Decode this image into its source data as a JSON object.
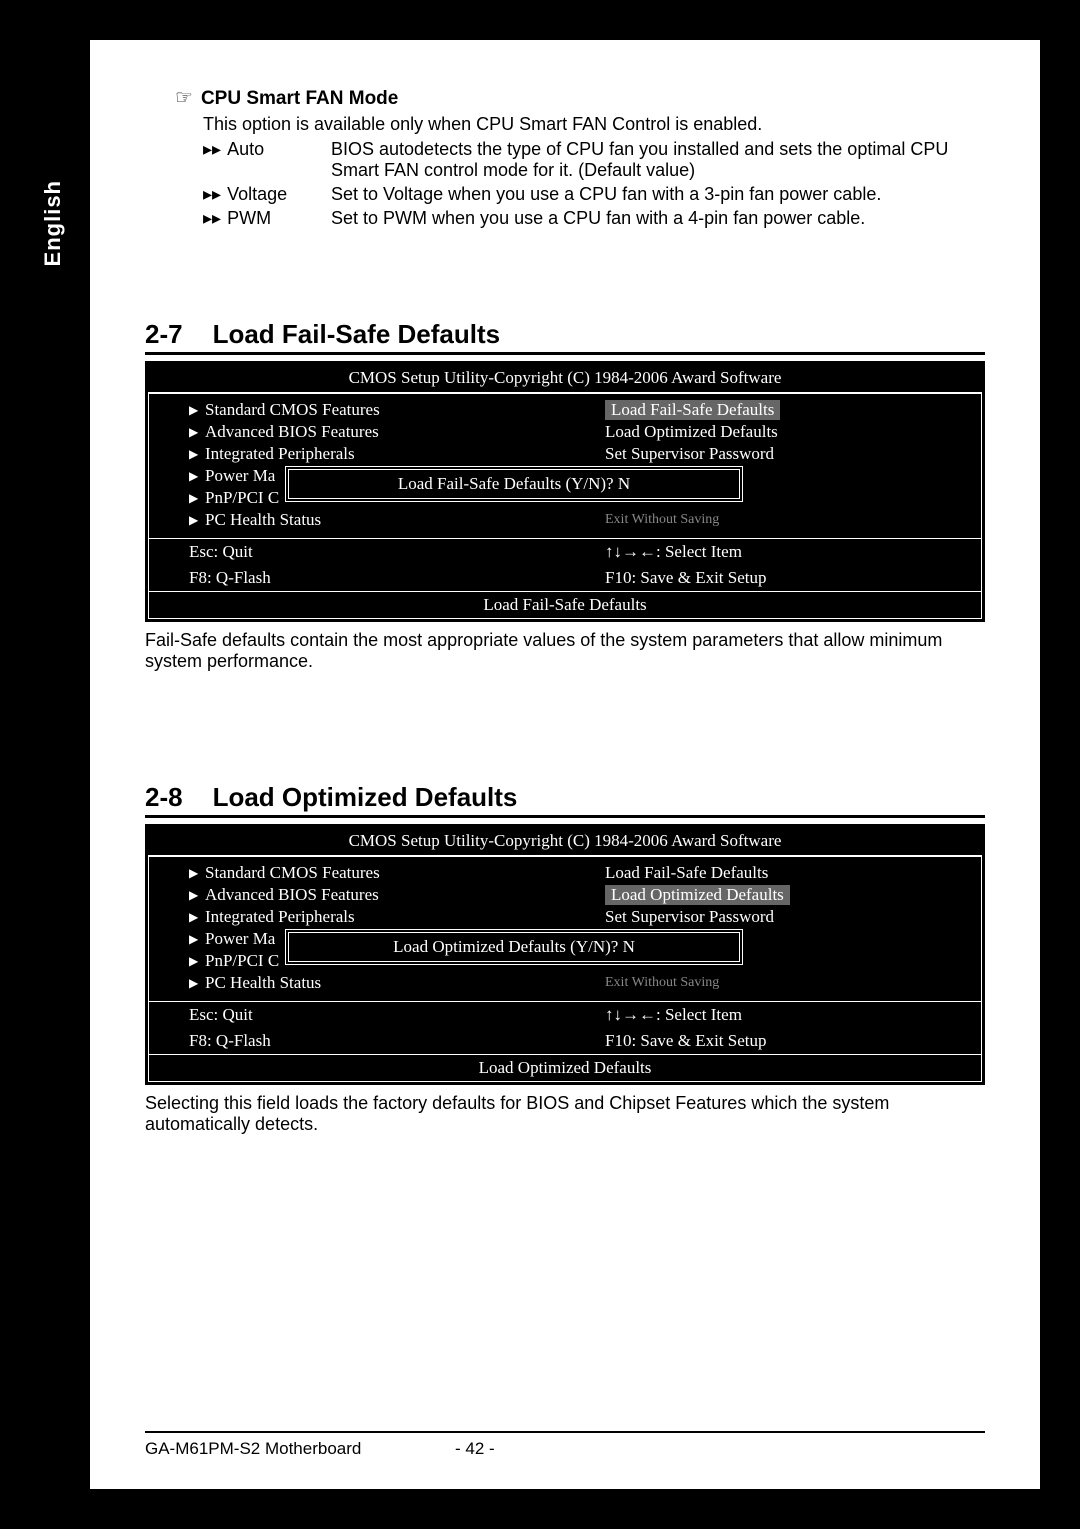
{
  "lang_tab": "English",
  "fan_mode": {
    "heading": "CPU Smart FAN Mode",
    "desc": "This option is available only when CPU Smart FAN Control is enabled.",
    "rows": [
      {
        "label": "Auto",
        "text": "BIOS autodetects the type of CPU fan you installed and sets the optimal CPU Smart FAN control mode for it. (Default value)"
      },
      {
        "label": "Voltage",
        "text": "Set to Voltage when you use a CPU fan with a 3-pin fan power cable."
      },
      {
        "label": "PWM",
        "text": "Set to PWM when you use a CPU fan with a 4-pin fan power cable."
      }
    ]
  },
  "sections": [
    {
      "num": "2-7",
      "title": "Load Fail-Safe Defaults",
      "bios": {
        "title": "CMOS Setup Utility-Copyright (C) 1984-2006 Award Software",
        "left": [
          "Standard CMOS Features",
          "Advanced BIOS Features",
          "Integrated Peripherals",
          "Power Ma",
          "PnP/PCI C",
          "PC Health Status"
        ],
        "right": [
          "Load Fail-Safe Defaults",
          "Load Optimized Defaults",
          "Set Supervisor Password",
          "",
          "",
          "Exit Without Saving"
        ],
        "right_highlight_index": 0,
        "dialog": "Load Fail-Safe Defaults (Y/N)? N",
        "footer": {
          "esc": "Esc: Quit",
          "select": "↑↓→←: Select Item",
          "f8": "F8: Q-Flash",
          "f10": "F10: Save & Exit Setup"
        },
        "status": "Load Fail-Safe Defaults"
      },
      "text": "Fail-Safe defaults contain the most appropriate values of the system parameters that allow minimum system performance."
    },
    {
      "num": "2-8",
      "title": "Load Optimized Defaults",
      "bios": {
        "title": "CMOS Setup Utility-Copyright (C) 1984-2006 Award Software",
        "left": [
          "Standard CMOS Features",
          "Advanced BIOS Features",
          "Integrated Peripherals",
          "Power Ma",
          "PnP/PCI C",
          "PC Health Status"
        ],
        "right": [
          "Load Fail-Safe Defaults",
          "Load Optimized Defaults",
          "Set Supervisor Password",
          "",
          "",
          "Exit Without Saving"
        ],
        "right_highlight_index": 1,
        "dialog": "Load Optimized Defaults (Y/N)? N",
        "footer": {
          "esc": "Esc: Quit",
          "select": "↑↓→←: Select Item",
          "f8": "F8: Q-Flash",
          "f10": "F10: Save & Exit Setup"
        },
        "status": "Load Optimized Defaults"
      },
      "text": "Selecting this field loads the factory defaults for BIOS and Chipset Features which the system automatically detects."
    }
  ],
  "footer": {
    "model": "GA-M61PM-S2 Motherboard",
    "page": "- 42 -"
  }
}
